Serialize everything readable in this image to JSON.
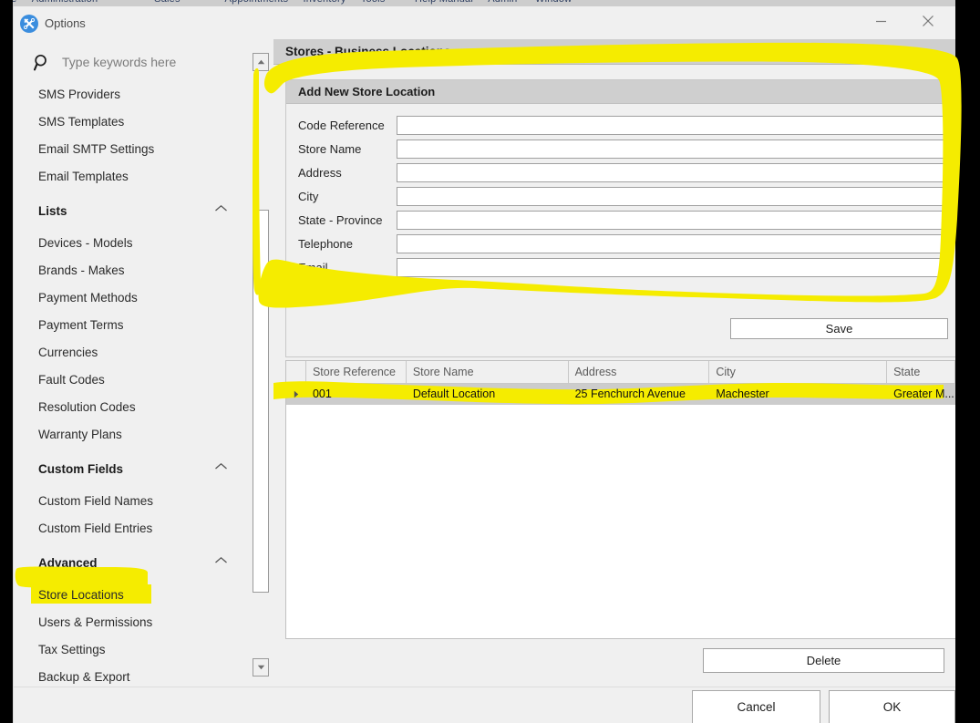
{
  "window": {
    "title": "Options",
    "icon": "tools-icon",
    "minimize_label": "–",
    "close_label": "✕"
  },
  "search": {
    "placeholder": "Type keywords here",
    "value": "",
    "icon": "search-icon"
  },
  "sidebar": {
    "items": [
      {
        "type": "item",
        "label": "SMS Providers"
      },
      {
        "type": "item",
        "label": "SMS Templates"
      },
      {
        "type": "item",
        "label": "Email SMTP Settings"
      },
      {
        "type": "item",
        "label": "Email Templates"
      },
      {
        "type": "header",
        "label": "Lists"
      },
      {
        "type": "item",
        "label": "Devices - Models"
      },
      {
        "type": "item",
        "label": "Brands - Makes"
      },
      {
        "type": "item",
        "label": "Payment Methods"
      },
      {
        "type": "item",
        "label": "Payment Terms"
      },
      {
        "type": "item",
        "label": "Currencies"
      },
      {
        "type": "item",
        "label": "Fault Codes"
      },
      {
        "type": "item",
        "label": "Resolution Codes"
      },
      {
        "type": "item",
        "label": "Warranty Plans"
      },
      {
        "type": "header",
        "label": "Custom Fields"
      },
      {
        "type": "item",
        "label": "Custom Field Names"
      },
      {
        "type": "item",
        "label": "Custom Field Entries"
      },
      {
        "type": "header",
        "label": "Advanced"
      },
      {
        "type": "item",
        "label": "Store Locations",
        "highlighted": true
      },
      {
        "type": "item",
        "label": "Users & Permissions"
      },
      {
        "type": "item",
        "label": "Tax Settings"
      },
      {
        "type": "item",
        "label": "Backup & Export"
      }
    ],
    "scroll_up_icon": "triangle-up-icon",
    "scroll_down_icon": "triangle-down-icon"
  },
  "main": {
    "header_title": "Stores - Business Locations",
    "form": {
      "title": "Add New Store Location",
      "fields": [
        {
          "label": "Code Reference",
          "value": "",
          "placeholder": ""
        },
        {
          "label": "Store Name",
          "value": "",
          "placeholder": ""
        },
        {
          "label": "Address",
          "value": "",
          "placeholder": ""
        },
        {
          "label": "City",
          "value": "",
          "placeholder": ""
        },
        {
          "label": "State - Province",
          "value": "",
          "placeholder": ""
        },
        {
          "label": "Telephone",
          "value": "",
          "placeholder": ""
        },
        {
          "label": "Email",
          "value": "",
          "placeholder": ""
        }
      ],
      "save_label": "Save"
    },
    "grid": {
      "columns": [
        {
          "label": "",
          "width": 22
        },
        {
          "label": "Store Reference",
          "width": 110
        },
        {
          "label": "Store Name",
          "width": 178
        },
        {
          "label": "Address",
          "width": 155
        },
        {
          "label": "City",
          "width": 195
        },
        {
          "label": "State",
          "width": 75
        }
      ],
      "rows": [
        {
          "selected": true,
          "row_marker_icon": "triangle-right-icon",
          "cells": [
            "",
            "001",
            "Default Location",
            "25 Fenchurch Avenue",
            "Machester",
            "Greater M..."
          ]
        }
      ]
    },
    "delete_label": "Delete"
  },
  "footer": {
    "cancel_label": "Cancel",
    "ok_label": "OK"
  },
  "colors": {
    "highlighter": "#f5ec00",
    "accent": "#3a8dde",
    "window_bg": "#f0f0f0",
    "header_bg": "#cfcfcf",
    "row_selected_bg": "#cccccc"
  }
}
